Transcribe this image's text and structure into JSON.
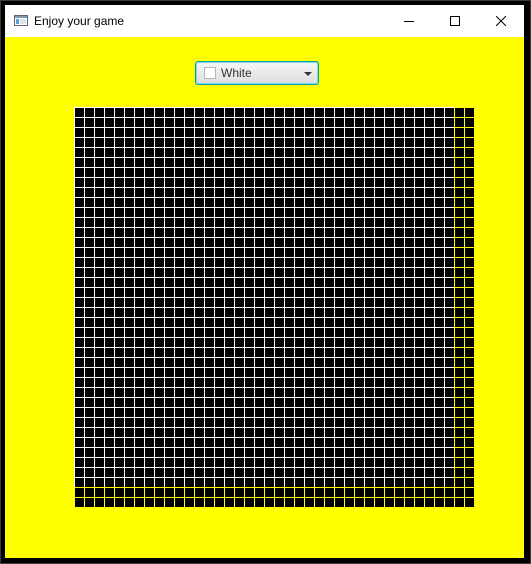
{
  "window": {
    "title": "Enjoy your game",
    "app_icon": "app-window-icon",
    "caption_buttons": {
      "minimize_icon": "minimize-icon",
      "maximize_icon": "maximize-icon",
      "close_icon": "close-icon"
    }
  },
  "toolbar": {
    "color_select": {
      "selected": "White",
      "swatch_color": "#ffffff",
      "dropdown_icon": "chevron-down-icon"
    }
  },
  "board": {
    "rows": 40,
    "columns": 40,
    "cell_color": "#000000",
    "grid_line_color": "#ffffff"
  },
  "colors": {
    "background": "#ffff00",
    "titlebar": "#ffffff",
    "combo_focus_border": "#00a6a6"
  }
}
